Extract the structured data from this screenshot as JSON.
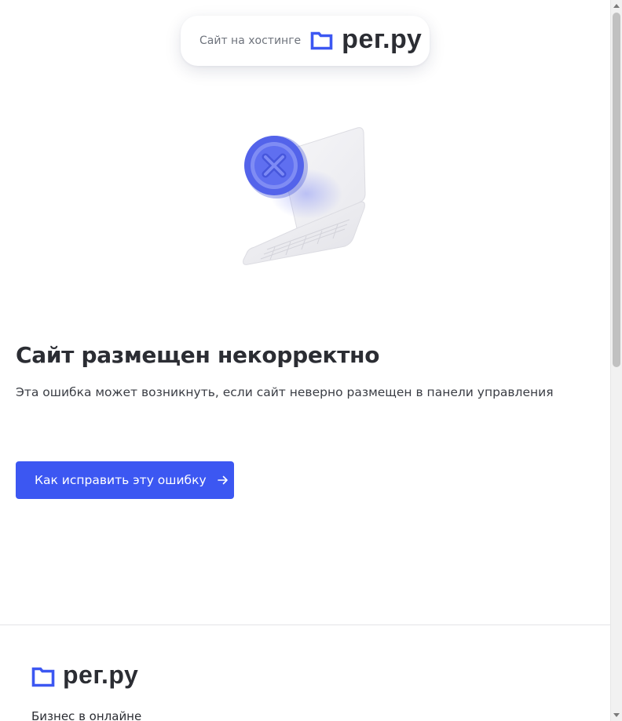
{
  "header": {
    "hosting_label": "Сайт на хостинге",
    "logo_text": "рег.ру"
  },
  "main": {
    "title": "Сайт размещен некорректно",
    "description": "Эта ошибка может возникнуть, если сайт неверно размещен в панели управления",
    "cta_label": "Как исправить эту ошибку"
  },
  "footer": {
    "logo_text": "рег.ру",
    "tagline": "Бизнес в онлайне"
  },
  "icons": {
    "logo": "folder-logo-icon",
    "illustration": "laptop-error-illustration",
    "cta_arrow": "arrow-right-icon"
  },
  "colors": {
    "brand_blue": "#3c57f2",
    "text_dark": "#2b2d33",
    "text_muted": "#6e737c"
  }
}
